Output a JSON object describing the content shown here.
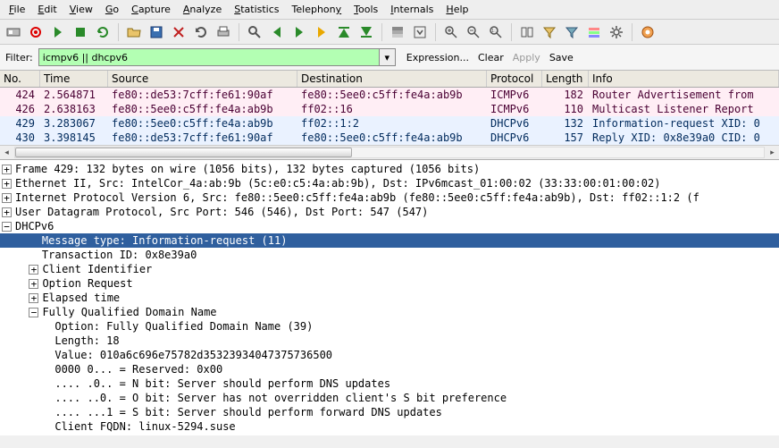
{
  "menu": {
    "file": "File",
    "edit": "Edit",
    "view": "View",
    "go": "Go",
    "capture": "Capture",
    "analyze": "Analyze",
    "statistics": "Statistics",
    "telephony": "Telephony",
    "tools": "Tools",
    "internals": "Internals",
    "help": "Help"
  },
  "filter": {
    "label": "Filter:",
    "value": "icmpv6 || dhcpv6",
    "expression": "Expression...",
    "clear": "Clear",
    "apply": "Apply",
    "save": "Save"
  },
  "columns": {
    "no": "No.",
    "time": "Time",
    "source": "Source",
    "destination": "Destination",
    "protocol": "Protocol",
    "length": "Length",
    "info": "Info"
  },
  "packets": [
    {
      "no": "424",
      "time": "2.564871",
      "src": "fe80::de53:7cff:fe61:90af",
      "dst": "fe80::5ee0:c5ff:fe4a:ab9b",
      "proto": "ICMPv6",
      "len": "182",
      "info": "Router Advertisement from",
      "cls": "pink"
    },
    {
      "no": "426",
      "time": "2.638163",
      "src": "fe80::5ee0:c5ff:fe4a:ab9b",
      "dst": "ff02::16",
      "proto": "ICMPv6",
      "len": "110",
      "info": "Multicast Listener Report",
      "cls": "pink"
    },
    {
      "no": "429",
      "time": "3.283067",
      "src": "fe80::5ee0:c5ff:fe4a:ab9b",
      "dst": "ff02::1:2",
      "proto": "DHCPv6",
      "len": "132",
      "info": "Information-request XID: 0",
      "cls": "blue"
    },
    {
      "no": "430",
      "time": "3.398145",
      "src": "fe80::de53:7cff:fe61:90af",
      "dst": "fe80::5ee0:c5ff:fe4a:ab9b",
      "proto": "DHCPv6",
      "len": "157",
      "info": "Reply XID: 0x8e39a0 CID: 0",
      "cls": "blue"
    }
  ],
  "details": {
    "frame": "Frame 429: 132 bytes on wire (1056 bits), 132 bytes captured (1056 bits)",
    "eth": "Ethernet II, Src: IntelCor_4a:ab:9b (5c:e0:c5:4a:ab:9b), Dst: IPv6mcast_01:00:02 (33:33:00:01:00:02)",
    "ipv6": "Internet Protocol Version 6, Src: fe80::5ee0:c5ff:fe4a:ab9b (fe80::5ee0:c5ff:fe4a:ab9b), Dst: ff02::1:2 (f",
    "udp": "User Datagram Protocol, Src Port: 546 (546), Dst Port: 547 (547)",
    "dhcpv6": "DHCPv6",
    "msg_type": "Message type: Information-request (11)",
    "txid": "Transaction ID: 0x8e39a0",
    "client_id": "Client Identifier",
    "opt_req": "Option Request",
    "elapsed": "Elapsed time",
    "fqdn": "Fully Qualified Domain Name",
    "fqdn_option": "Option: Fully Qualified Domain Name (39)",
    "fqdn_length": "Length: 18",
    "fqdn_value": "Value: 010a6c696e75782d35323934047375736500",
    "fqdn_reserved": "0000 0... = Reserved: 0x00",
    "fqdn_n": ".... .0.. = N bit: Server should perform DNS updates",
    "fqdn_o": ".... ..0. = O bit: Server has not overridden client's S bit preference",
    "fqdn_s": ".... ...1 = S bit: Server should perform forward DNS updates",
    "fqdn_client": "Client FQDN: linux-5294.suse"
  }
}
